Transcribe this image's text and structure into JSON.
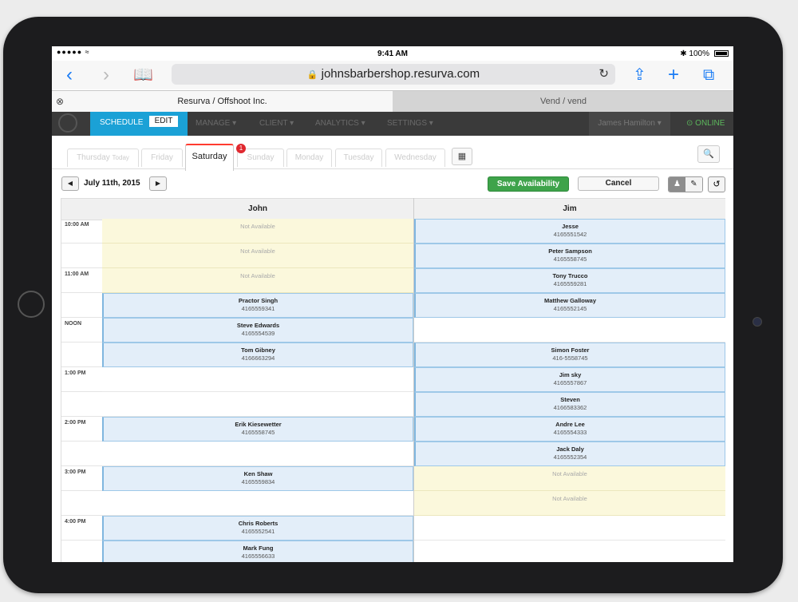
{
  "status": {
    "dots": "●●●●● ≈",
    "time": "9:41 AM",
    "battery": "✱ 100%"
  },
  "browser": {
    "url": "johnsbarbershop.resurva.com",
    "tabs": [
      {
        "label": "Resurva / Offshoot Inc."
      },
      {
        "label": "Vend / vend"
      }
    ]
  },
  "nav": {
    "schedule": "SCHEDULE",
    "edit": "EDIT",
    "items": [
      "MANAGE ▾",
      "CLIENT ▾",
      "ANALYTICS ▾",
      "SETTINGS ▾"
    ],
    "user": "James Hamilton ▾",
    "online": "ONLINE"
  },
  "days": [
    {
      "label": "Thursday",
      "sub": "Today"
    },
    {
      "label": "Friday"
    },
    {
      "label": "Saturday",
      "badge": "1"
    },
    {
      "label": "Sunday"
    },
    {
      "label": "Monday"
    },
    {
      "label": "Tuesday"
    },
    {
      "label": "Wednesday"
    }
  ],
  "date": "July 11th, 2015",
  "buttons": {
    "save": "Save Availability",
    "cancel": "Cancel"
  },
  "staff": [
    "John",
    "Jim"
  ],
  "times": [
    "10:00 AM",
    "",
    "11:00 AM",
    "",
    "NOON",
    "",
    "1:00 PM",
    "",
    "2:00 PM",
    "",
    "3:00 PM",
    "",
    "4:00 PM",
    ""
  ],
  "columns": [
    [
      {
        "type": "na",
        "text": "Not Available"
      },
      {
        "type": "na",
        "text": "Not Available"
      },
      {
        "type": "na",
        "text": "Not Available"
      },
      {
        "type": "appt",
        "name": "Practor Singh",
        "phone": "4165559341"
      },
      {
        "type": "appt",
        "name": "Steve Edwards",
        "phone": "4165554539"
      },
      {
        "type": "appt",
        "name": "Tom Gibney",
        "phone": "4166663294"
      },
      {
        "type": "empty"
      },
      {
        "type": "empty"
      },
      {
        "type": "appt",
        "name": "Erik Kiesewetter",
        "phone": "4165558745"
      },
      {
        "type": "empty"
      },
      {
        "type": "appt",
        "name": "Ken Shaw",
        "phone": "4165559834"
      },
      {
        "type": "empty"
      },
      {
        "type": "appt",
        "name": "Chris Roberts",
        "phone": "4165552541"
      },
      {
        "type": "appt",
        "name": "Mark Fung",
        "phone": "4165556633"
      }
    ],
    [
      {
        "type": "appt",
        "name": "Jesse",
        "phone": "4165551542"
      },
      {
        "type": "appt",
        "name": "Peter Sampson",
        "phone": "4165558745"
      },
      {
        "type": "appt",
        "name": "Tony Trucco",
        "phone": "4165559281"
      },
      {
        "type": "appt",
        "name": "Matthew Galloway",
        "phone": "4165552145"
      },
      {
        "type": "empty"
      },
      {
        "type": "appt",
        "name": "Simon Foster",
        "phone": "416-5558745"
      },
      {
        "type": "appt",
        "name": "Jim sky",
        "phone": "4165557867"
      },
      {
        "type": "appt",
        "name": "Steven",
        "phone": "4166583362"
      },
      {
        "type": "appt",
        "name": "Andre Lee",
        "phone": "4165554333"
      },
      {
        "type": "appt",
        "name": "Jack Daly",
        "phone": "4165552354"
      },
      {
        "type": "na",
        "text": "Not Available"
      },
      {
        "type": "na",
        "text": "Not Available"
      },
      {
        "type": "empty"
      },
      {
        "type": "empty"
      }
    ]
  ]
}
